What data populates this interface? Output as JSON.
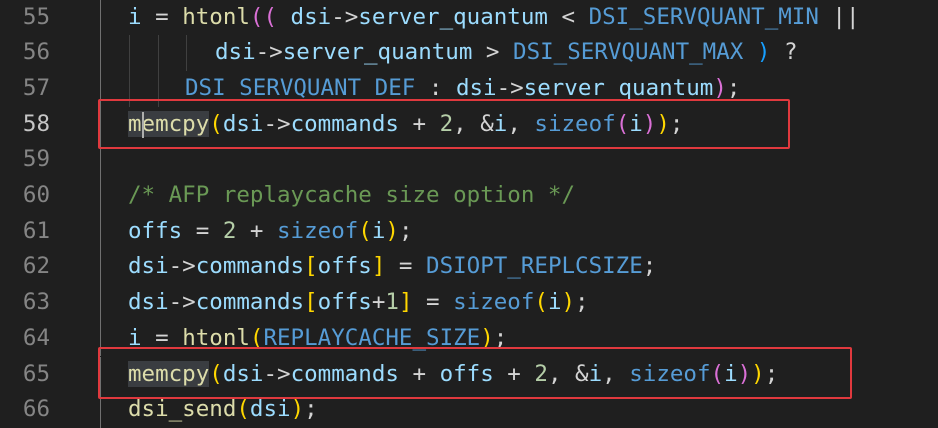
{
  "editor": {
    "lines": [
      {
        "num": "55",
        "tokens": [
          {
            "t": "i",
            "c": "var"
          },
          {
            "t": " = ",
            "c": "op"
          },
          {
            "t": "htonl",
            "c": "fn"
          },
          {
            "t": "((",
            "c": "brk1"
          },
          {
            "t": " dsi",
            "c": "var"
          },
          {
            "t": "->",
            "c": "op"
          },
          {
            "t": "server_quantum",
            "c": "var"
          },
          {
            "t": " < ",
            "c": "op"
          },
          {
            "t": "DSI_SERVQUANT_MIN",
            "c": "kw"
          },
          {
            "t": " ||",
            "c": "op"
          }
        ]
      },
      {
        "num": "56",
        "tokens": [
          {
            "t": "dsi",
            "c": "var"
          },
          {
            "t": "->",
            "c": "op"
          },
          {
            "t": "server_quantum",
            "c": "var"
          },
          {
            "t": " > ",
            "c": "op"
          },
          {
            "t": "DSI_SERVQUANT_MAX",
            "c": "kw"
          },
          {
            "t": " )",
            "c": "brk2"
          },
          {
            "t": " ?",
            "c": "op"
          }
        ]
      },
      {
        "num": "57",
        "tokens": [
          {
            "t": "DSI_SERVQUANT_DEF",
            "c": "kw"
          },
          {
            "t": " : ",
            "c": "op"
          },
          {
            "t": "dsi",
            "c": "var"
          },
          {
            "t": "->",
            "c": "op"
          },
          {
            "t": "server_quantum",
            "c": "var"
          },
          {
            "t": ")",
            "c": "brk1"
          },
          {
            "t": ";",
            "c": "op"
          }
        ]
      },
      {
        "num": "58",
        "tokens": [
          {
            "t": "memcpy",
            "c": "fn"
          },
          {
            "t": "(",
            "c": "brk3"
          },
          {
            "t": "dsi",
            "c": "var"
          },
          {
            "t": "->",
            "c": "op"
          },
          {
            "t": "commands",
            "c": "var"
          },
          {
            "t": " + ",
            "c": "op"
          },
          {
            "t": "2",
            "c": "num"
          },
          {
            "t": ", &",
            "c": "op"
          },
          {
            "t": "i",
            "c": "var"
          },
          {
            "t": ", ",
            "c": "op"
          },
          {
            "t": "sizeof",
            "c": "kw"
          },
          {
            "t": "(",
            "c": "brk1"
          },
          {
            "t": "i",
            "c": "var"
          },
          {
            "t": ")",
            "c": "brk1"
          },
          {
            "t": ")",
            "c": "brk3"
          },
          {
            "t": ";",
            "c": "op"
          }
        ]
      },
      {
        "num": "59",
        "tokens": []
      },
      {
        "num": "60",
        "tokens": [
          {
            "t": "/* AFP replaycache size option */",
            "c": "comment"
          }
        ]
      },
      {
        "num": "61",
        "tokens": [
          {
            "t": "offs",
            "c": "var"
          },
          {
            "t": " = ",
            "c": "op"
          },
          {
            "t": "2",
            "c": "num"
          },
          {
            "t": " + ",
            "c": "op"
          },
          {
            "t": "sizeof",
            "c": "kw"
          },
          {
            "t": "(",
            "c": "brk3"
          },
          {
            "t": "i",
            "c": "var"
          },
          {
            "t": ")",
            "c": "brk3"
          },
          {
            "t": ";",
            "c": "op"
          }
        ]
      },
      {
        "num": "62",
        "tokens": [
          {
            "t": "dsi",
            "c": "var"
          },
          {
            "t": "->",
            "c": "op"
          },
          {
            "t": "commands",
            "c": "var"
          },
          {
            "t": "[",
            "c": "brk3"
          },
          {
            "t": "offs",
            "c": "var"
          },
          {
            "t": "]",
            "c": "brk3"
          },
          {
            "t": " = ",
            "c": "op"
          },
          {
            "t": "DSIOPT_REPLCSIZE",
            "c": "kw"
          },
          {
            "t": ";",
            "c": "op"
          }
        ]
      },
      {
        "num": "63",
        "tokens": [
          {
            "t": "dsi",
            "c": "var"
          },
          {
            "t": "->",
            "c": "op"
          },
          {
            "t": "commands",
            "c": "var"
          },
          {
            "t": "[",
            "c": "brk3"
          },
          {
            "t": "offs",
            "c": "var"
          },
          {
            "t": "+",
            "c": "op"
          },
          {
            "t": "1",
            "c": "num"
          },
          {
            "t": "]",
            "c": "brk3"
          },
          {
            "t": " = ",
            "c": "op"
          },
          {
            "t": "sizeof",
            "c": "kw"
          },
          {
            "t": "(",
            "c": "brk3"
          },
          {
            "t": "i",
            "c": "var"
          },
          {
            "t": ")",
            "c": "brk3"
          },
          {
            "t": ";",
            "c": "op"
          }
        ]
      },
      {
        "num": "64",
        "tokens": [
          {
            "t": "i",
            "c": "var"
          },
          {
            "t": " = ",
            "c": "op"
          },
          {
            "t": "htonl",
            "c": "fn"
          },
          {
            "t": "(",
            "c": "brk3"
          },
          {
            "t": "REPLAYCACHE_SIZE",
            "c": "kw"
          },
          {
            "t": ")",
            "c": "brk3"
          },
          {
            "t": ";",
            "c": "op"
          }
        ]
      },
      {
        "num": "65",
        "tokens": [
          {
            "t": "memcpy",
            "c": "fn"
          },
          {
            "t": "(",
            "c": "brk3"
          },
          {
            "t": "dsi",
            "c": "var"
          },
          {
            "t": "->",
            "c": "op"
          },
          {
            "t": "commands",
            "c": "var"
          },
          {
            "t": " + ",
            "c": "op"
          },
          {
            "t": "offs",
            "c": "var"
          },
          {
            "t": " + ",
            "c": "op"
          },
          {
            "t": "2",
            "c": "num"
          },
          {
            "t": ", &",
            "c": "op"
          },
          {
            "t": "i",
            "c": "var"
          },
          {
            "t": ", ",
            "c": "op"
          },
          {
            "t": "sizeof",
            "c": "kw"
          },
          {
            "t": "(",
            "c": "brk1"
          },
          {
            "t": "i",
            "c": "var"
          },
          {
            "t": ")",
            "c": "brk1"
          },
          {
            "t": ")",
            "c": "brk3"
          },
          {
            "t": ";",
            "c": "op"
          }
        ]
      },
      {
        "num": "66",
        "tokens": [
          {
            "t": "dsi_send",
            "c": "fn"
          },
          {
            "t": "(",
            "c": "brk3"
          },
          {
            "t": "dsi",
            "c": "var"
          },
          {
            "t": ")",
            "c": "brk3"
          },
          {
            "t": ";",
            "c": "op"
          }
        ]
      }
    ],
    "active_line": "58",
    "highlighted_lines": [
      "58",
      "65"
    ],
    "colors": {
      "background": "#1f1f1f",
      "line_number": "#858585",
      "active_line_number": "#c6c6c6",
      "function": "#dcdcaa",
      "variable": "#9cdcfe",
      "keyword": "#569cd6",
      "number": "#b5cea8",
      "comment": "#6a9955",
      "highlight_box": "#e0393e"
    }
  }
}
